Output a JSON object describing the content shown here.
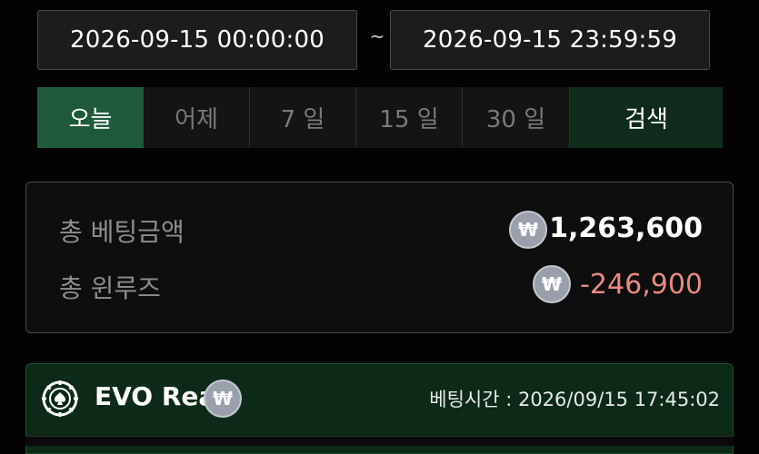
{
  "date_range": {
    "start": "2026-09-15 00:00:00",
    "separator": "~",
    "end": "2026-09-15 23:59:59"
  },
  "filters": {
    "today": "오늘",
    "yesterday": "어제",
    "days7": "7 일",
    "days15": "15 일",
    "days30": "30 일",
    "search": "검색"
  },
  "summary": {
    "total_bet_label": "총 베팅금액",
    "total_bet_value": "1,263,600",
    "total_winloss_label": "총 윈루즈",
    "total_winloss_value": "-246,900",
    "currency_symbol": "₩"
  },
  "game_entry": {
    "title": "EVO Real",
    "bet_time_label": "베팅시간 :",
    "bet_time": "2026/09/15 17:45:02"
  },
  "colors": {
    "active_tab": "#1e5a3a",
    "search_button": "#0f2b1b",
    "negative_value": "#e88a82",
    "game_header": "#0c2a17"
  }
}
